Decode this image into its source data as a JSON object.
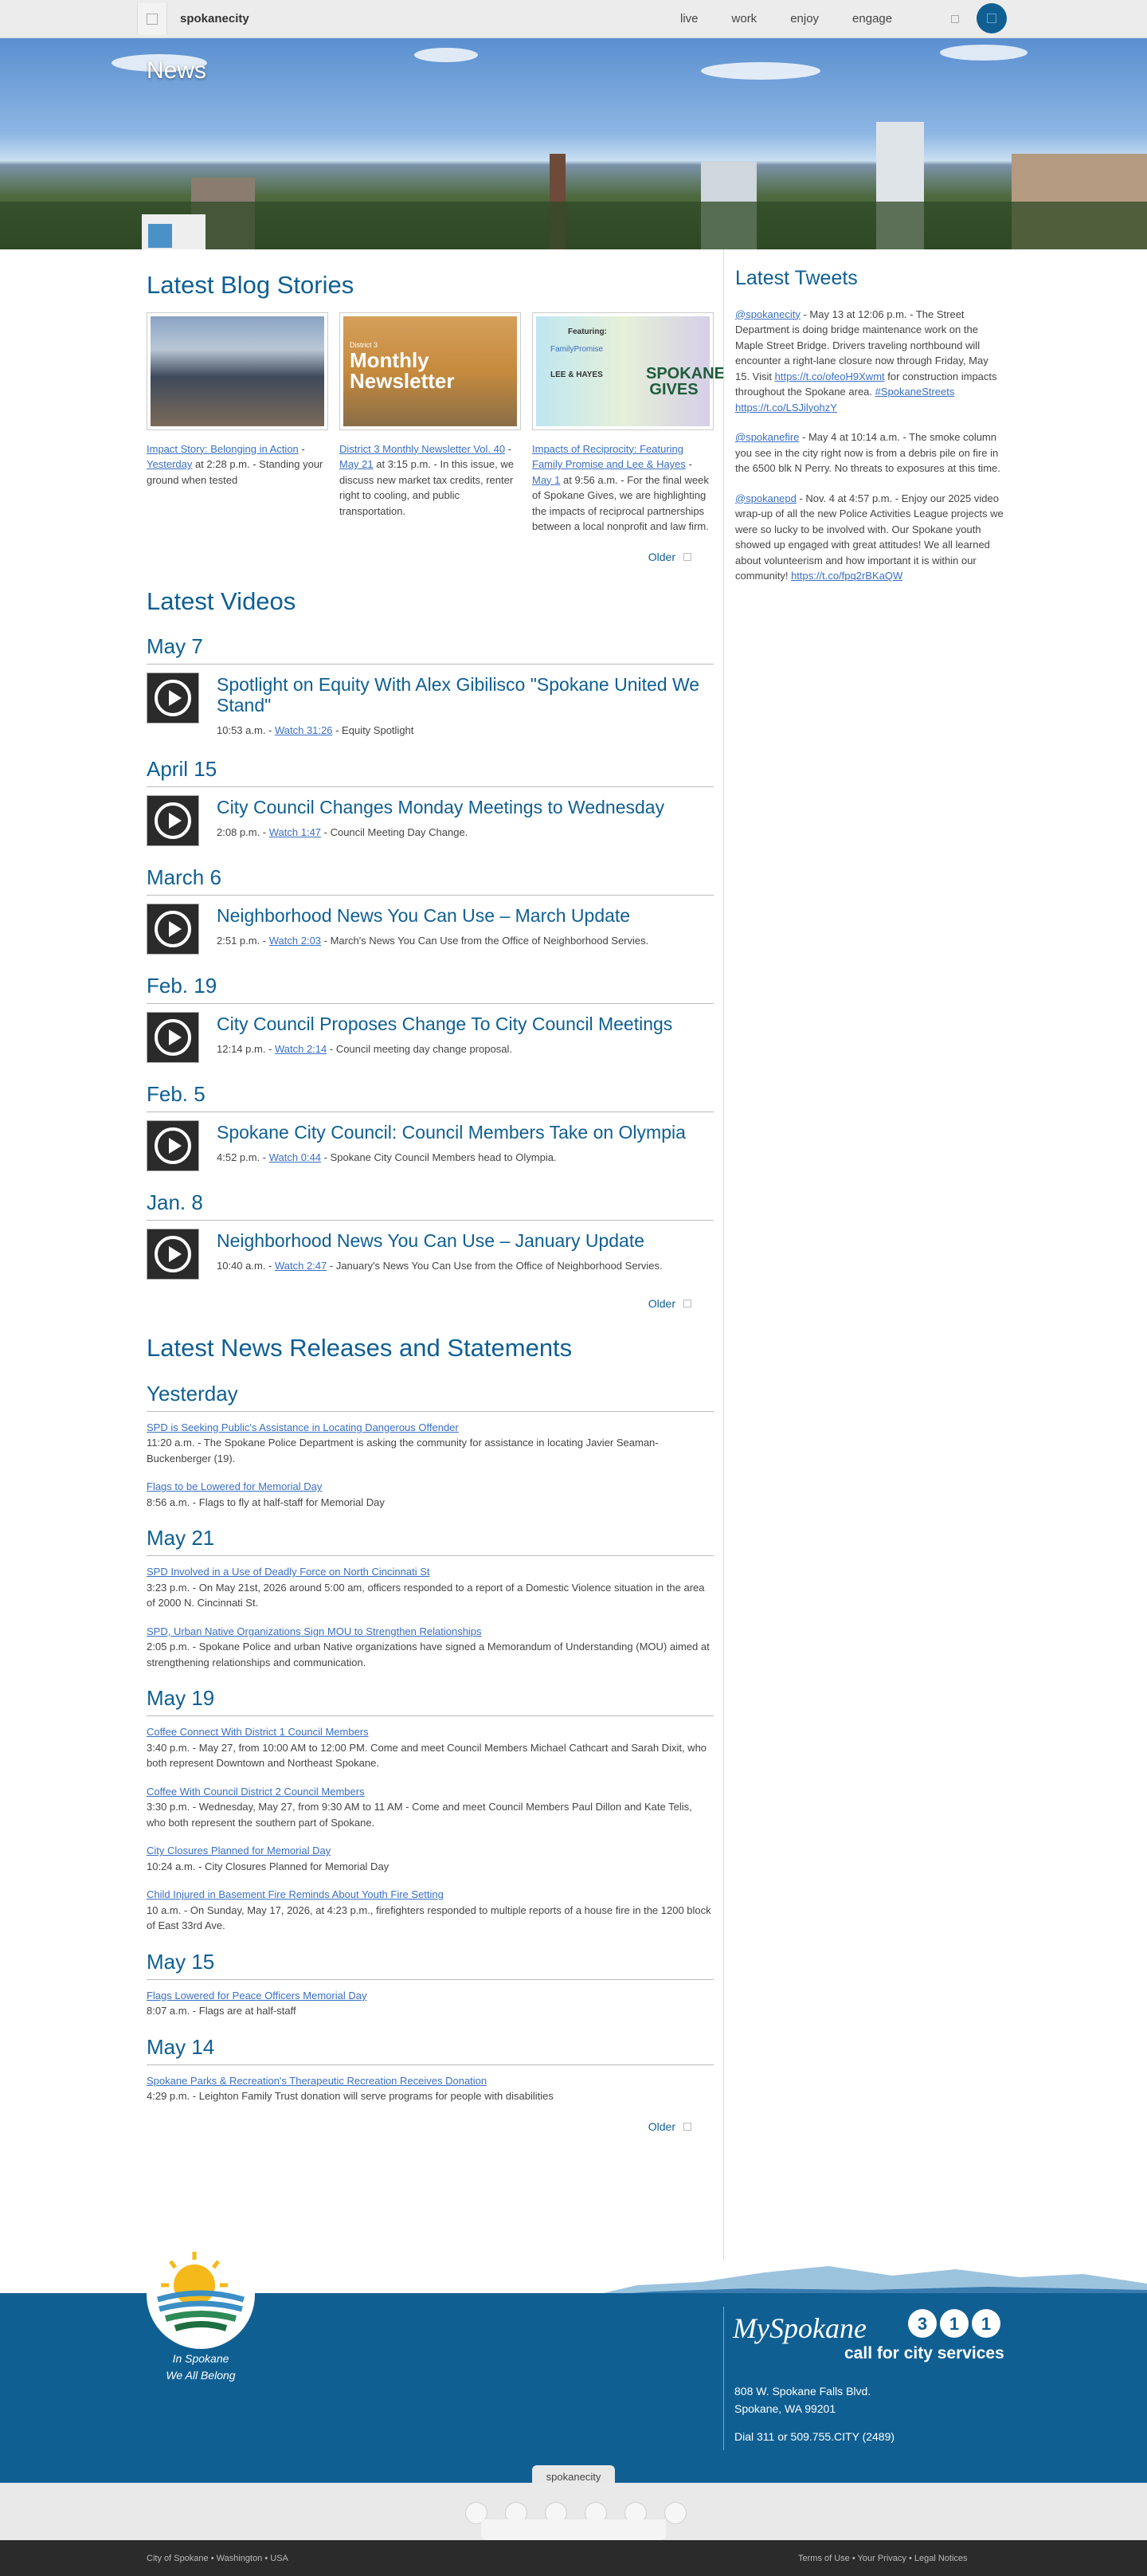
{
  "topbar": {
    "logo": "spokanecity",
    "nav": [
      "live",
      "work",
      "enjoy",
      "engage"
    ]
  },
  "hero": {
    "title": "News"
  },
  "blog": {
    "heading": "Latest Blog Stories",
    "older": "Older",
    "items": [
      {
        "title": "Impact Story: Belonging in Action",
        "date": "Yesterday",
        "meta": " at 2:28 p.m. - Standing your ground when tested"
      },
      {
        "title": "District 3 Monthly Newsletter Vol. 40",
        "date": "May 21",
        "meta": " at 3:15 p.m. - In this issue, we discuss new market tax credits, renter right to cooling, and public transportation.",
        "thumb_text": "Monthly Newsletter",
        "thumb_small": "District 3"
      },
      {
        "title": "Impacts of Reciprocity: Featuring Family Promise and Lee & Hayes",
        "date": "May 1",
        "meta": " at 9:56 a.m. - For the final week of Spokane Gives, we are highlighting the impacts of reciprocal partnerships between a local nonprofit and law firm.",
        "thumb_featuring": "Featuring:",
        "thumb_fp": "FamilyPromise",
        "thumb_lh": "LEE & HAYES",
        "thumb_sg": "SPOKANE GIVES"
      }
    ]
  },
  "videos": {
    "heading": "Latest Videos",
    "older": "Older",
    "groups": [
      {
        "day": "May 7",
        "title": "Spotlight on Equity With Alex Gibilisco \"Spokane United We Stand\"",
        "time": "10:53 a.m. - ",
        "watch": "Watch 31:26",
        "desc": " - Equity Spotlight"
      },
      {
        "day": "April 15",
        "title": "City Council Changes Monday Meetings to Wednesday",
        "time": "2:08 p.m. - ",
        "watch": "Watch 1:47",
        "desc": " - Council Meeting Day Change."
      },
      {
        "day": "March 6",
        "title": "Neighborhood News You Can Use – March Update",
        "time": "2:51 p.m. - ",
        "watch": "Watch 2:03",
        "desc": " - March's News You Can Use from the Office of Neighborhood Servies."
      },
      {
        "day": "Feb. 19",
        "title": "City Council Proposes Change To City Council Meetings",
        "time": "12:14 p.m. - ",
        "watch": "Watch 2:14",
        "desc": " - Council meeting day change proposal."
      },
      {
        "day": "Feb. 5",
        "title": "Spokane City Council: Council Members Take on Olympia",
        "time": "4:52 p.m. - ",
        "watch": "Watch 0:44",
        "desc": " - Spokane City Council Members head to Olympia."
      },
      {
        "day": "Jan. 8",
        "title": "Neighborhood News You Can Use – January Update",
        "time": "10:40 a.m. - ",
        "watch": "Watch 2:47",
        "desc": " - January's News You Can Use from the Office of Neighborhood Servies."
      }
    ]
  },
  "news": {
    "heading": "Latest News Releases and Statements",
    "older": "Older",
    "groups": [
      {
        "day": "Yesterday",
        "items": [
          {
            "title": "SPD is Seeking Public's Assistance in Locating Dangerous Offender",
            "text": "11:20 a.m. - The Spokane Police Department is asking the community for assistance in locating Javier Seaman-Buckenberger (19)."
          },
          {
            "title": "Flags to be Lowered for Memorial Day",
            "text": "8:56 a.m. - Flags to fly at half-staff for Memorial Day"
          }
        ]
      },
      {
        "day": "May 21",
        "items": [
          {
            "title": "SPD Involved in a Use of Deadly Force on North Cincinnati St",
            "text": "3:23 p.m. - On May 21st, 2026 around 5:00 am, officers responded to a report of a Domestic Violence situation in the area of 2000 N. Cincinnati St."
          },
          {
            "title": "SPD, Urban Native Organizations Sign MOU to Strengthen Relationships",
            "text": "2:05 p.m. - Spokane Police and urban Native organizations have signed a Memorandum of Understanding (MOU) aimed at strengthening relationships and communication."
          }
        ]
      },
      {
        "day": "May 19",
        "items": [
          {
            "title": "Coffee Connect With District 1 Council Members",
            "text": "3:40 p.m. - May 27, from 10:00 AM to 12:00 PM. Come and meet Council Members Michael Cathcart and Sarah Dixit, who both represent Downtown and Northeast Spokane."
          },
          {
            "title": "Coffee With Council District 2 Council Members",
            "text": "3:30 p.m. - Wednesday, May 27, from 9:30 AM to 11 AM - Come and meet Council Members Paul Dillon and Kate Telis, who both represent the southern part of Spokane."
          },
          {
            "title": "City Closures Planned for Memorial Day",
            "text": "10:24 a.m. - City Closures Planned for Memorial Day"
          },
          {
            "title": "Child Injured in Basement Fire Reminds About Youth Fire Setting",
            "text": "10 a.m. - On Sunday, May 17, 2026, at 4:23 p.m., firefighters responded to multiple reports of a house fire in the 1200 block of East 33rd Ave."
          }
        ]
      },
      {
        "day": "May 15",
        "items": [
          {
            "title": "Flags Lowered for Peace Officers Memorial Day",
            "text": "8:07 a.m. - Flags are at half-staff"
          }
        ]
      },
      {
        "day": "May 14",
        "items": [
          {
            "title": "Spokane Parks & Recreation's Therapeutic Recreation Receives Donation",
            "text": "4:29 p.m. - Leighton Family Trust donation will serve programs for people with disabilities"
          }
        ]
      }
    ]
  },
  "tweets": {
    "heading": "Latest Tweets",
    "items": [
      {
        "handle": "@spokanecity",
        "pre": " - May 13 at 12:06 p.m. - The Street Department is doing bridge maintenance work on the Maple Street Bridge. Drivers traveling northbound will encounter a right-lane closure now through Friday, May 15. Visit ",
        "link1": "https://t.co/ofeoH9Xwmt",
        "mid": " for construction impacts throughout the Spokane area. ",
        "tag": "#SpokaneStreets",
        "sp": " ",
        "link2": "https://t.co/LSJilyohzY"
      },
      {
        "handle": "@spokanefire",
        "pre": " - May 4 at 10:14 a.m. - The smoke column you see in the city right now is from a debris pile on fire in the 6500 blk N Perry. No threats to exposures at this time."
      },
      {
        "handle": "@spokanepd",
        "pre": " - Nov. 4 at 4:57 p.m. - Enjoy our 2025 video wrap-up of all the new Police Activities League projects we were so lucky to be involved with. Our Spokane youth showed up engaged with great attitudes! We all learned about volunteerism and how important it is within our community! ",
        "link1": "https://t.co/fpq2rBKaQW"
      }
    ]
  },
  "footer": {
    "tag1": "In Spokane",
    "tag2": "We All Belong",
    "my": "MySpokane",
    "digits": [
      "3",
      "1",
      "1"
    ],
    "call": "call for city services",
    "addr1": "808 W. Spokane Falls Blvd.",
    "addr2": "Spokane, WA 99201",
    "phone": "Dial 311 or 509.755.CITY (2489)",
    "pill": "spokanecity",
    "bottom_left": "City of Spokane  •  Washington  •  USA",
    "bottom_right": "Terms of Use  •  Your Privacy  •  Legal Notices"
  },
  "colors": {
    "brand": "#0f5f93",
    "link": "#3a6fc4"
  }
}
